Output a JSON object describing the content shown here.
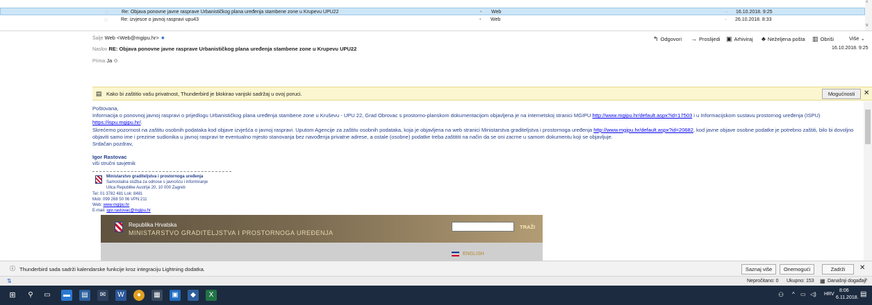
{
  "message_list": {
    "rows": [
      {
        "subject": "Re: Objava ponovne javne rasprave Urbanističkog plana uređenja stambene zone u Krupevu UPU22",
        "from": "Web",
        "date": "16.10.2018. 9:25",
        "selected": true
      },
      {
        "subject": "Re: izvjesce o javnoj raspravi upu43",
        "from": "Web",
        "date": "26.10.2018. 8:33",
        "selected": false
      }
    ]
  },
  "header": {
    "from_label": "Šalje",
    "from_value": "Web <Web@mgipu.hr>",
    "subject_label": "Naslov",
    "subject_value": "RE: Objava ponovne javne rasprave Urbanističkog plana uređenja stambene zone u Krupevu UPU22",
    "to_label": "Prima",
    "to_value": "Ja",
    "date": "16.10.2018. 9:25",
    "toolbar": {
      "reply": "Odgovori",
      "forward": "Proslijedi",
      "archive": "Arhiviraj",
      "junk": "Neželjena pošta",
      "delete": "Obriši",
      "more": "Više"
    }
  },
  "infobar": {
    "text": "Kako bi zaštitio vašu privatnost, Thunderbird je blokirao vanjski sadržaj u ovoj poruci.",
    "options": "Mogućnosti"
  },
  "body": {
    "greeting": "Poštovana,",
    "p1_a": "Informacija o ponovnoj javnoj raspravi o prijedlogu Urbanističkog plana uređenja stambene zone u Kruševu - UPU 22, Grad Obrovac s prostorno-planskom dokumentacijom objavljena je na internetskoj stranici MGIPU ",
    "p1_link1": "http://www.mgipu.hr/default.aspx?id=17503",
    "p1_b": " i u Informacijskom sustavu prostornog uređenja (ISPU) ",
    "p1_link2": "https://ispu.mgipu.hr/",
    "p1_c": ".",
    "p2_a": "Skrećemo pozornost na zaštitu osobnih podataka kod objave izvješća o javnoj raspravi. Uputom Agencije za zaštitu osobnih podataka, koja je objavljena na web stranici Ministarstva graditeljstva i prostornoga uređenja ",
    "p2_link": "http://www.mgipu.hr/default.aspx?id=20682",
    "p2_b": ", kod javne objave osobne podatke je potrebno zaštiti, bilo bi dovoljno objaviti samo ime i prezime sudionika u javnoj raspravi te eventualno mjesto stanovanja bez navođenja privatne adrese, a ostale (osobne) podatke treba zaštititi na način da se oni zacrne u samom dokumentu koji se objavljuje.",
    "closing": "Srdačan pozdrav,",
    "sig_name": "Igor Rastovac",
    "sig_title": "viši stručni savjetnik",
    "sig_org": "Ministarstvo graditeljstva i prostornoga uređenja",
    "sig_dept": "Samostalna služba za odnose s javnošću i informiranje",
    "sig_address": "Ulica Republike Austrije 20, 10 000 Zagreb",
    "sig_tel": "Tel: 01 3782 481   Lok: 8481",
    "sig_mob": "Mob: 099 268 50 06   VPN:211",
    "sig_web_label": "Web: ",
    "sig_web": "www.mgipu.hr",
    "sig_mail_label": "E-mail: ",
    "sig_mail": "igor.rastovac@mgipu.hr"
  },
  "banner": {
    "line1": "Republika Hrvatska",
    "line2": "MINISTARSTVO GRADITELJSTVA I PROSTORNOGA UREĐENJA",
    "search_button": "TRAŽI",
    "english": "ENGLISH"
  },
  "notification": {
    "text": "Thunderbird sada sadrži kalendarske funkcije kroz integraciju Lightning dodatka.",
    "learn_more": "Saznaj više",
    "disable": "Onemogući",
    "keep": "Zadrži"
  },
  "status": {
    "unread": "Nepročitano: 0",
    "total": "Ukupno: 153",
    "today": "Današnji događaji"
  },
  "taskbar": {
    "language": "HRV",
    "time": "8:06",
    "date": "6.11.2018."
  },
  "colors": {
    "accent": "#1e64c8",
    "selection": "#cde6f7",
    "infobar": "#fbf6cf",
    "taskbar": "#1c2b3f",
    "body_text": "#26408c"
  }
}
